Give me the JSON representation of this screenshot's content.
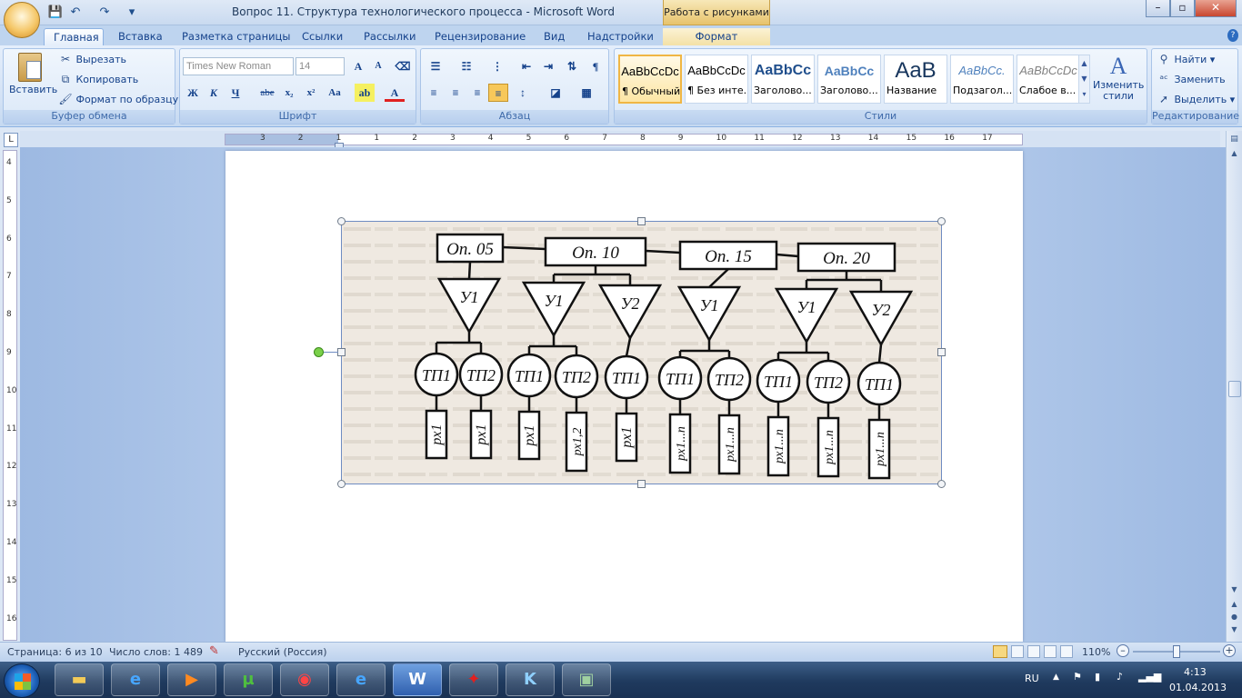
{
  "window": {
    "title": "Вопрос 11. Структура технологического процесса - Microsoft Word",
    "context_tab_title": "Работа с рисунками",
    "controls": [
      "minimize",
      "maximize",
      "close"
    ]
  },
  "quick_access": [
    "save-icon",
    "undo-icon",
    "redo-icon",
    "customize-icon"
  ],
  "tabs": [
    {
      "label": "Главная",
      "active": true
    },
    {
      "label": "Вставка"
    },
    {
      "label": "Разметка страницы"
    },
    {
      "label": "Ссылки"
    },
    {
      "label": "Рассылки"
    },
    {
      "label": "Рецензирование"
    },
    {
      "label": "Вид"
    },
    {
      "label": "Надстройки"
    },
    {
      "label": "Формат",
      "contextual": true
    }
  ],
  "ribbon": {
    "clipboard": {
      "label": "Буфер обмена",
      "paste": "Вставить",
      "cut": "Вырезать",
      "copy": "Копировать",
      "format_painter": "Формат по образцу"
    },
    "font": {
      "label": "Шрифт",
      "font_name": "Times New Roman",
      "font_size": "14",
      "bold": "Ж",
      "italic": "К",
      "underline": "Ч",
      "strike": "abe",
      "subscript": "x₂",
      "superscript": "x²",
      "case": "Aa",
      "grow": "A",
      "shrink": "A"
    },
    "paragraph": {
      "label": "Абзац"
    },
    "styles": {
      "label": "Стили",
      "items": [
        {
          "sample": "AaBbCcDc",
          "name": "¶ Обычный"
        },
        {
          "sample": "AaBbCcDc",
          "name": "¶ Без инте..."
        },
        {
          "sample": "AaBbCc",
          "name": "Заголово..."
        },
        {
          "sample": "AaBbCc",
          "name": "Заголово..."
        },
        {
          "sample": "AaB",
          "name": "Название"
        },
        {
          "sample": "AaBbCc.",
          "name": "Подзагол..."
        },
        {
          "sample": "AaBbCcDc",
          "name": "Слабое в..."
        }
      ],
      "change_styles": "Изменить стили"
    },
    "editing": {
      "label": "Редактирование",
      "find": "Найти",
      "replace": "Заменить",
      "select": "Выделить"
    }
  },
  "ruler": {
    "h_marks": [
      "3",
      "2",
      "1",
      "1",
      "2",
      "3",
      "4",
      "5",
      "6",
      "7",
      "8",
      "9",
      "10",
      "11",
      "12",
      "13",
      "14",
      "15",
      "16",
      "17"
    ],
    "v_marks": [
      "4",
      "5",
      "6",
      "7",
      "8",
      "9",
      "10",
      "11",
      "12",
      "13",
      "14",
      "15",
      "16"
    ]
  },
  "diagram": {
    "operations": [
      "Оп. 05",
      "Оп. 10",
      "Оп. 15",
      "Оп. 20"
    ],
    "devices": [
      "У1",
      "У1",
      "У2",
      "У1",
      "У1",
      "У2"
    ],
    "transitions": [
      "ТП1",
      "ТП2",
      "ТП1",
      "ТП2",
      "ТП1",
      "ТП1",
      "ТП2",
      "ТП1",
      "ТП2",
      "ТП1"
    ],
    "moves": [
      "px1",
      "px1",
      "px1",
      "px1,2",
      "px1",
      "px1...n",
      "px1...n",
      "px1...n",
      "px1...n",
      "px1...n"
    ]
  },
  "statusbar": {
    "page": "Страница: 6 из 10",
    "words": "Число слов: 1 489",
    "language": "Русский (Россия)",
    "zoom": "110%"
  },
  "taskbar": {
    "apps": [
      "explorer",
      "ie",
      "media-player",
      "utorrent",
      "chrome",
      "ie",
      "word",
      "acrobat",
      "k-app",
      "image-viewer"
    ],
    "lang": "RU",
    "time": "4:13",
    "date": "01.04.2013"
  }
}
